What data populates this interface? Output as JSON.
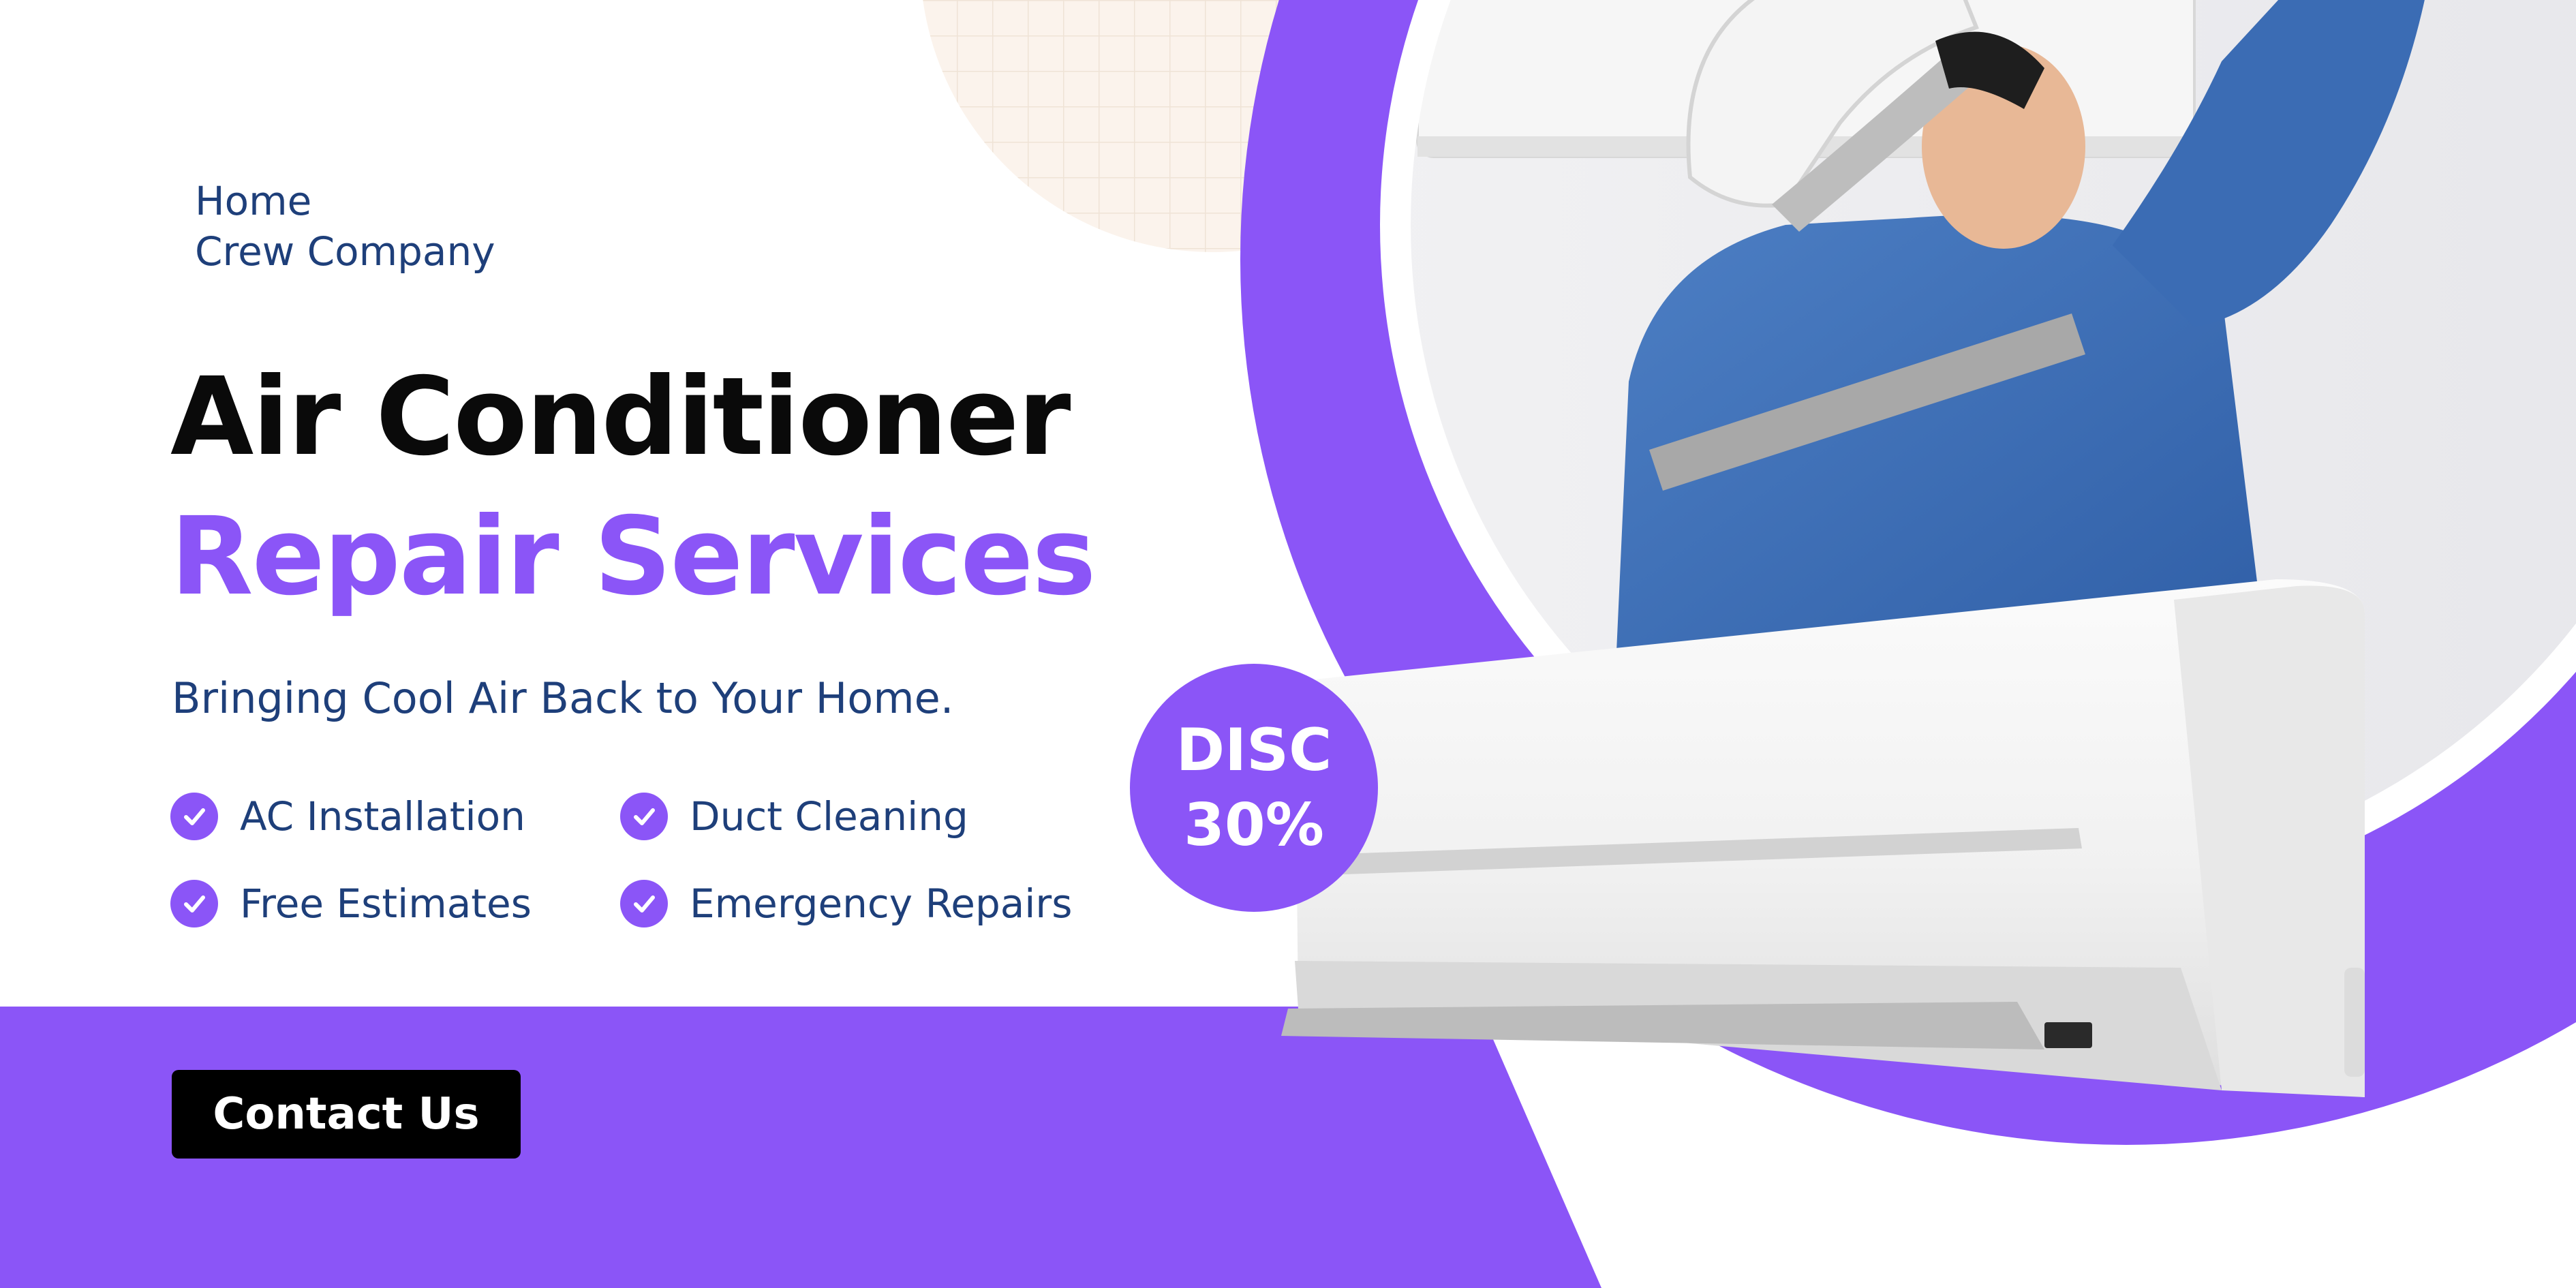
{
  "brand": {
    "line1": "Home",
    "line2": "Crew Company"
  },
  "headline": {
    "line1": "Air Conditioner",
    "line2": "Repair Services"
  },
  "tagline": "Bringing Cool Air Back to Your Home.",
  "features": [
    {
      "label": "AC Installation",
      "icon": "check-circle-icon"
    },
    {
      "label": "Duct Cleaning",
      "icon": "check-circle-icon"
    },
    {
      "label": "Free Estimates",
      "icon": "check-circle-icon"
    },
    {
      "label": "Emergency Repairs",
      "icon": "check-circle-icon"
    }
  ],
  "cta": {
    "label": "Contact Us"
  },
  "badge": {
    "line1": "DISC",
    "line2": "30%"
  },
  "colors": {
    "accent": "#8b55f7",
    "brand_text": "#1e3f7a",
    "headline_dark": "#0a0a0a",
    "button_bg": "#000000",
    "grid_blob": "#fbf3ec"
  }
}
